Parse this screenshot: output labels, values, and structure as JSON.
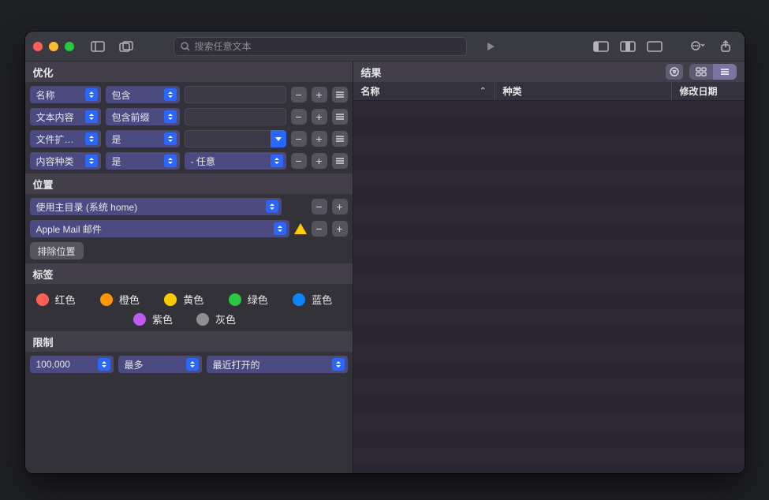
{
  "toolbar": {
    "search_placeholder": "搜索任意文本"
  },
  "sidebar": {
    "refine_header": "优化",
    "rows": [
      {
        "attr": "名称",
        "op": "包含"
      },
      {
        "attr": "文本内容",
        "op": "包含前缀"
      },
      {
        "attr": "文件扩展名",
        "op": "是"
      },
      {
        "attr": "内容种类",
        "op": "是",
        "val": "- 任意"
      }
    ],
    "location_header": "位置",
    "locations": [
      "使用主目录 (系统 home)",
      "Apple Mail 邮件"
    ],
    "exclude_label": "排除位置",
    "tags_header": "标签",
    "tags": [
      {
        "label": "红色",
        "color": "#ff5f57"
      },
      {
        "label": "橙色",
        "color": "#ff9500"
      },
      {
        "label": "黄色",
        "color": "#ffcc00"
      },
      {
        "label": "绿色",
        "color": "#28c840"
      },
      {
        "label": "蓝色",
        "color": "#0a84ff"
      },
      {
        "label": "紫色",
        "color": "#bf5af2"
      },
      {
        "label": "灰色",
        "color": "#8e8e93"
      }
    ],
    "limit_header": "限制",
    "limit": {
      "count": "100,000",
      "kind": "最多",
      "by": "最近打开的"
    }
  },
  "results": {
    "header": "结果",
    "columns": {
      "name": "名称",
      "kind": "种类",
      "modified": "修改日期"
    }
  }
}
